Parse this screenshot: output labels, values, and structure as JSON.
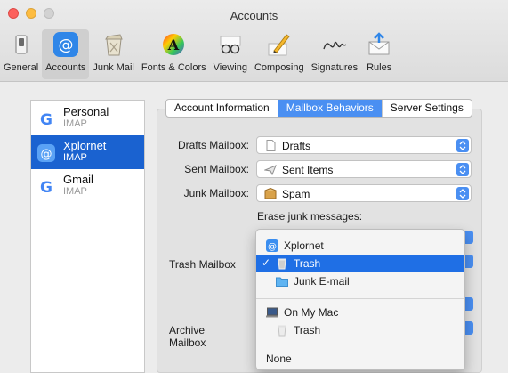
{
  "window": {
    "title": "Accounts"
  },
  "toolbar": {
    "items": [
      {
        "label": "General",
        "icon": "general-switch-icon"
      },
      {
        "label": "Accounts",
        "icon": "at-sign-icon",
        "active": true
      },
      {
        "label": "Junk Mail",
        "icon": "junk-trash-icon"
      },
      {
        "label": "Fonts & Colors",
        "icon": "fonts-colors-icon"
      },
      {
        "label": "Viewing",
        "icon": "glasses-icon"
      },
      {
        "label": "Composing",
        "icon": "pencil-icon"
      },
      {
        "label": "Signatures",
        "icon": "signature-icon"
      },
      {
        "label": "Rules",
        "icon": "rules-envelope-icon"
      }
    ]
  },
  "sidebar": {
    "accounts": [
      {
        "name": "Personal",
        "type": "IMAP",
        "icon": "google-icon"
      },
      {
        "name": "Xplornet",
        "type": "IMAP",
        "icon": "at-sign-icon",
        "selected": true
      },
      {
        "name": "Gmail",
        "type": "IMAP",
        "icon": "google-icon"
      }
    ]
  },
  "tabs": [
    {
      "label": "Account Information"
    },
    {
      "label": "Mailbox Behaviors",
      "active": true
    },
    {
      "label": "Server Settings"
    }
  ],
  "form": {
    "drafts": {
      "label": "Drafts Mailbox:",
      "value": "Drafts",
      "icon": "document-icon"
    },
    "sent": {
      "label": "Sent Mailbox:",
      "value": "Sent Items",
      "icon": "paper-plane-icon"
    },
    "junk": {
      "label": "Junk Mailbox:",
      "value": "Spam",
      "icon": "spam-box-icon"
    },
    "erase_junk_label": "Erase junk messages:",
    "trash_label": "Trash Mailbox",
    "archive_label": "Archive Mailbox"
  },
  "menu": {
    "xplornet_header": "Xplornet",
    "trash_selected": "Trash",
    "junk_email": "Junk E-mail",
    "on_my_mac": "On My Mac",
    "mac_trash": "Trash",
    "none": "None",
    "check": "✓"
  },
  "colors": {
    "accent": "#1f6fe5",
    "tab_active": "#4a8ff2",
    "sidebar_selected": "#1a62d0"
  }
}
